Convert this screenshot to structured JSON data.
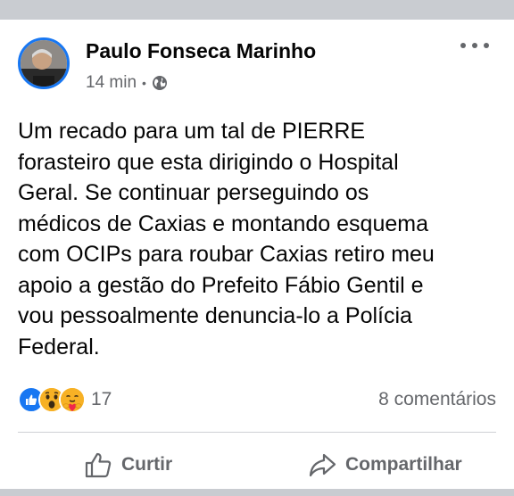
{
  "post": {
    "author": "Paulo Fonseca Marinho",
    "time": "14 min",
    "separator": "•",
    "privacy_icon": "globe-icon",
    "text": "Um recado para um tal de PIERRE\nforasteiro que esta dirigindo o Hospital\nGeral. Se continuar perseguindo os\nmédicos de Caxias e montando esquema\ncom OCIPs para roubar Caxias retiro meu\napoio a gestão do Prefeito Fábio Gentil e\nvou pessoalmente denuncia-lo a Polícia\nFederal."
  },
  "reactions": {
    "icons": [
      "like-icon",
      "wow-icon",
      "care-icon"
    ],
    "count": "17",
    "comments": "8 comentários"
  },
  "actions": {
    "like_label": "Curtir",
    "share_label": "Compartilhar"
  },
  "colors": {
    "accent": "#1877f2",
    "secondary_text": "#65676b",
    "reaction_yellow": "#f7b125"
  }
}
